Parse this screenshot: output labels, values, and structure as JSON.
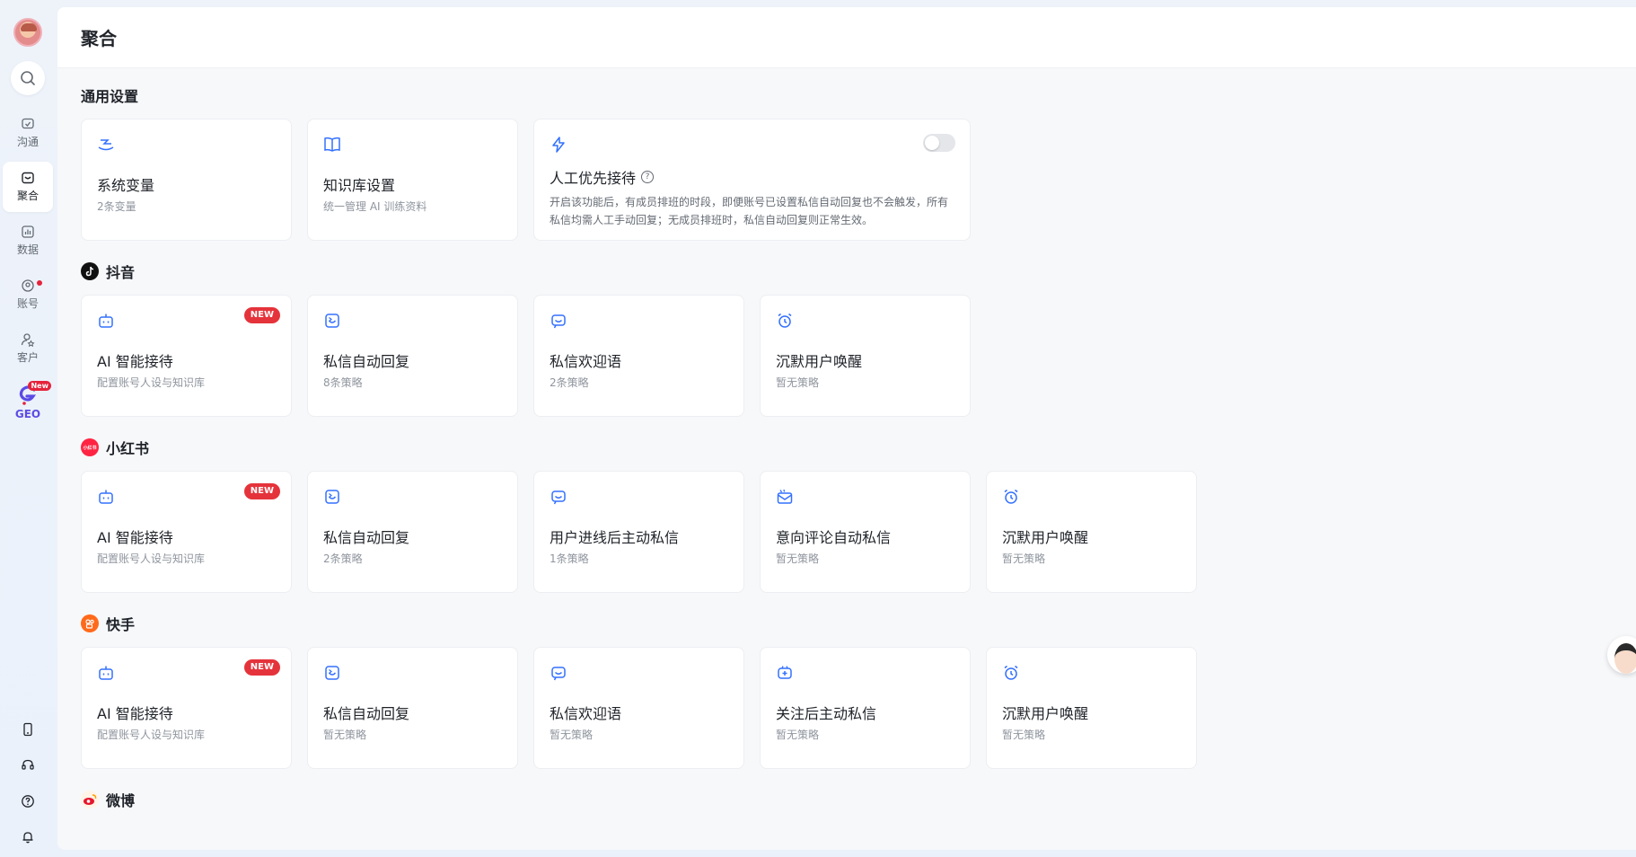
{
  "sidebar": {
    "items": [
      {
        "label": "沟通",
        "icon": "chat-icon"
      },
      {
        "label": "聚合",
        "icon": "aggregate-icon"
      },
      {
        "label": "数据",
        "icon": "chart-icon"
      },
      {
        "label": "账号",
        "icon": "account-icon"
      },
      {
        "label": "客户",
        "icon": "customer-icon"
      },
      {
        "label": "GEO",
        "badge": "New",
        "icon": "geo-logo-icon"
      }
    ]
  },
  "header": {
    "title": "聚合"
  },
  "general": {
    "title": "通用设置",
    "system_vars": {
      "title": "系统变量",
      "sub": "2条变量"
    },
    "knowledge": {
      "title": "知识库设置",
      "sub": "统一管理 AI 训练资料"
    },
    "manual_priority": {
      "title": "人工优先接待",
      "desc": "开启该功能后，有成员排班的时段，即便账号已设置私信自动回复也不会触发，所有私信均需人工手动回复；无成员排班时，私信自动回复则正常生效。"
    }
  },
  "badge_new": "NEW",
  "douyin": {
    "title": "抖音",
    "cards": [
      {
        "title": "AI 智能接待",
        "sub": "配置账号人设与知识库"
      },
      {
        "title": "私信自动回复",
        "sub": "8条策略"
      },
      {
        "title": "私信欢迎语",
        "sub": "2条策略"
      },
      {
        "title": "沉默用户唤醒",
        "sub": "暂无策略"
      }
    ]
  },
  "xiaohongshu": {
    "title": "小红书",
    "icon_text": "小红书",
    "cards": [
      {
        "title": "AI 智能接待",
        "sub": "配置账号人设与知识库"
      },
      {
        "title": "私信自动回复",
        "sub": "2条策略"
      },
      {
        "title": "用户进线后主动私信",
        "sub": "1条策略"
      },
      {
        "title": "意向评论自动私信",
        "sub": "暂无策略"
      },
      {
        "title": "沉默用户唤醒",
        "sub": "暂无策略"
      }
    ]
  },
  "kuaishou": {
    "title": "快手",
    "cards": [
      {
        "title": "AI 智能接待",
        "sub": "配置账号人设与知识库"
      },
      {
        "title": "私信自动回复",
        "sub": "暂无策略"
      },
      {
        "title": "私信欢迎语",
        "sub": "暂无策略"
      },
      {
        "title": "关注后主动私信",
        "sub": "暂无策略"
      },
      {
        "title": "沉默用户唤醒",
        "sub": "暂无策略"
      }
    ]
  },
  "weibo": {
    "title": "微博"
  },
  "colors": {
    "accent": "#3370ff",
    "badge": "#e5333b"
  }
}
